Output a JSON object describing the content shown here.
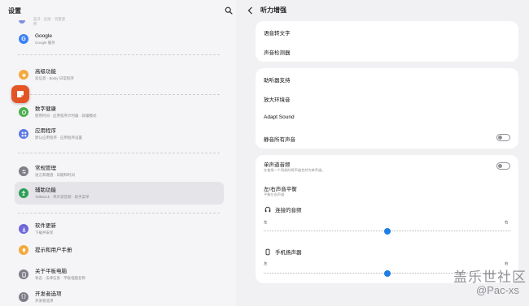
{
  "left": {
    "title": "设置",
    "top_partial_text": "蓝牙 · 连接 · 流量使用",
    "items": [
      {
        "label": "Google",
        "sub": "Google 服务",
        "icon": "google-icon",
        "color": "#3b82f6"
      },
      {
        "label": "高级功能",
        "sub": "双信息 · Bixby 日常程序",
        "icon": "star-icon",
        "color": "#f3a93b"
      },
      {
        "label": "数字健康",
        "sub": "使用时间 · 应用程序计时器 · 就寝模式",
        "icon": "leaf-icon",
        "color": "#4caf50"
      },
      {
        "label": "应用程序",
        "sub": "默认应用程序 · 应用程序设置",
        "icon": "apps-icon",
        "color": "#5a7ae6"
      },
      {
        "label": "常规管理",
        "sub": "语言和键盘 · 日期和时间",
        "icon": "sliders-icon",
        "color": "#7e7e88"
      },
      {
        "label": "辅助功能",
        "sub": "TalkBack · 单声道音频 · 助手菜单",
        "icon": "accessibility-icon",
        "color": "#2e9e57"
      },
      {
        "label": "软件更新",
        "sub": "下载并安装",
        "icon": "update-icon",
        "color": "#6d67d8"
      },
      {
        "label": "提示和用户手册",
        "sub": "",
        "icon": "bulb-icon",
        "color": "#f3a93b"
      },
      {
        "label": "关于平板电脑",
        "sub": "状态 · 法律信息 · 平板电脑名称",
        "icon": "info-icon",
        "color": "#7e7e88"
      },
      {
        "label": "开发者选项",
        "sub": "开发者选项",
        "icon": "braces-icon",
        "color": "#7e7e88"
      }
    ],
    "active_item": "辅助功能"
  },
  "right": {
    "title": "听力增强",
    "card1": [
      "语音转文字",
      "声音检测器"
    ],
    "card2": {
      "hearing_aid": "助听器支持",
      "amplify": "放大环境音",
      "adapt": "Adapt Sound",
      "mute_all": "静音所有声音",
      "mute_all_on": false
    },
    "card3": {
      "mono_label": "单声道音频",
      "mono_sub": "在使用一个耳机时将声道合并为单声道。",
      "mono_on": false,
      "balance_label": "左/右声音平衡",
      "balance_sub": "平衡左右声道",
      "connected_audio": "连接的音频",
      "device_speaker": "手机扬声器",
      "left": "左",
      "right": "右",
      "connected_balance": 0.5,
      "speaker_balance": 0.5
    }
  },
  "watermark": {
    "line1": "盖乐世社区",
    "line2": "@Pac-xs"
  }
}
